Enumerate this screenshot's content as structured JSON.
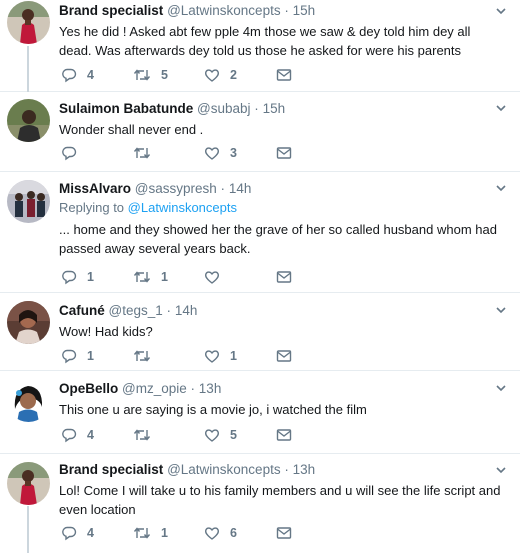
{
  "tweets": [
    {
      "name": "Brand specialist",
      "handle": "@Latwinskoncepts",
      "time": "15h",
      "replying_prefix": "",
      "replying_to": "",
      "text_lines": [
        "Yes he did ! Asked abt few pple 4m those we saw & dey told him dey all",
        "dead. Was afterwards dey told us those he asked for were his parents"
      ],
      "replies": "4",
      "retweets": "5",
      "likes": "2",
      "avatar": "woman-red-dress"
    },
    {
      "name": "Sulaimon Babatunde",
      "handle": "@subabj",
      "time": "15h",
      "replying_prefix": "",
      "replying_to": "",
      "text_lines": [
        "Wonder shall never end ."
      ],
      "replies": "",
      "retweets": "",
      "likes": "3",
      "avatar": "man-outdoor"
    },
    {
      "name": "MissAlvaro",
      "handle": "@sassypresh",
      "time": "14h",
      "replying_prefix": "Replying to",
      "replying_to": "@Latwinskoncepts",
      "text_lines": [
        "... home and they showed her the grave of her so called husband whom had",
        "passed away several years back."
      ],
      "replies": "1",
      "retweets": "1",
      "likes": "",
      "avatar": "group-photo"
    },
    {
      "name": "Cafuné",
      "handle": "@tegs_1",
      "time": "14h",
      "replying_prefix": "",
      "replying_to": "",
      "text_lines": [
        "Wow! Had kids?"
      ],
      "replies": "1",
      "retweets": "",
      "likes": "1",
      "avatar": "woman-portrait"
    },
    {
      "name": "OpeBello",
      "handle": "@mz_opie",
      "time": "13h",
      "replying_prefix": "",
      "replying_to": "",
      "text_lines": [
        "This one u are saying is a movie jo, i watched the film"
      ],
      "replies": "4",
      "retweets": "",
      "likes": "5",
      "avatar": "woman-blue"
    },
    {
      "name": "Brand specialist",
      "handle": "@Latwinskoncepts",
      "time": "13h",
      "replying_prefix": "",
      "replying_to": "",
      "text_lines": [
        "Lol! Come I will take u to his family members and u will see the life script and",
        "even location"
      ],
      "replies": "4",
      "retweets": "1",
      "likes": "6",
      "avatar": "woman-red-dress"
    }
  ],
  "separator": "·",
  "icons": {
    "reply": "reply-icon",
    "retweet": "retweet-icon",
    "like": "heart-icon",
    "dm": "envelope-icon",
    "more": "chevron-down-icon"
  },
  "colors": {
    "muted": "#657786",
    "accent": "#1da1f2",
    "text": "#14171a",
    "divider": "#e6ecf0"
  }
}
